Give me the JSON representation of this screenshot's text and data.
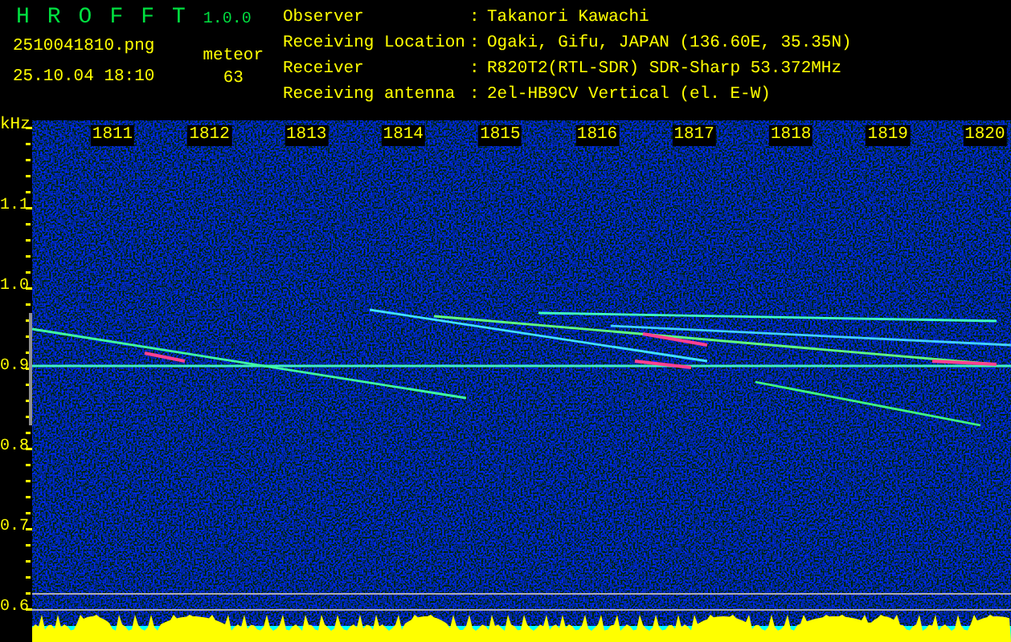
{
  "app": {
    "title": "HROFFT",
    "version": "1.0.0"
  },
  "capture": {
    "file": "2510041810.png",
    "datetime": "25.10.04 18:10",
    "count_label": "meteor",
    "count": "63"
  },
  "info": [
    {
      "label": "Observer",
      "sep": ":",
      "value": "Takanori Kawachi"
    },
    {
      "label": "Receiving Location",
      "sep": ":",
      "value": "Ogaki, Gifu, JAPAN (136.60E, 35.35N)"
    },
    {
      "label": "Receiver",
      "sep": ":",
      "value": "R820T2(RTL-SDR) SDR-Sharp 53.372MHz"
    },
    {
      "label": "Receiving antenna",
      "sep": ":",
      "value": "2el-HB9CV Vertical (el. E-W)"
    }
  ],
  "plot": {
    "unit": "kHz",
    "x_ticks": [
      "1811",
      "1812",
      "1813",
      "1814",
      "1815",
      "1816",
      "1817",
      "1818",
      "1819",
      "1820"
    ],
    "y_ticks": [
      "1.1",
      "1.0",
      "0.9",
      "0.8",
      "0.7",
      "0.6"
    ]
  }
}
